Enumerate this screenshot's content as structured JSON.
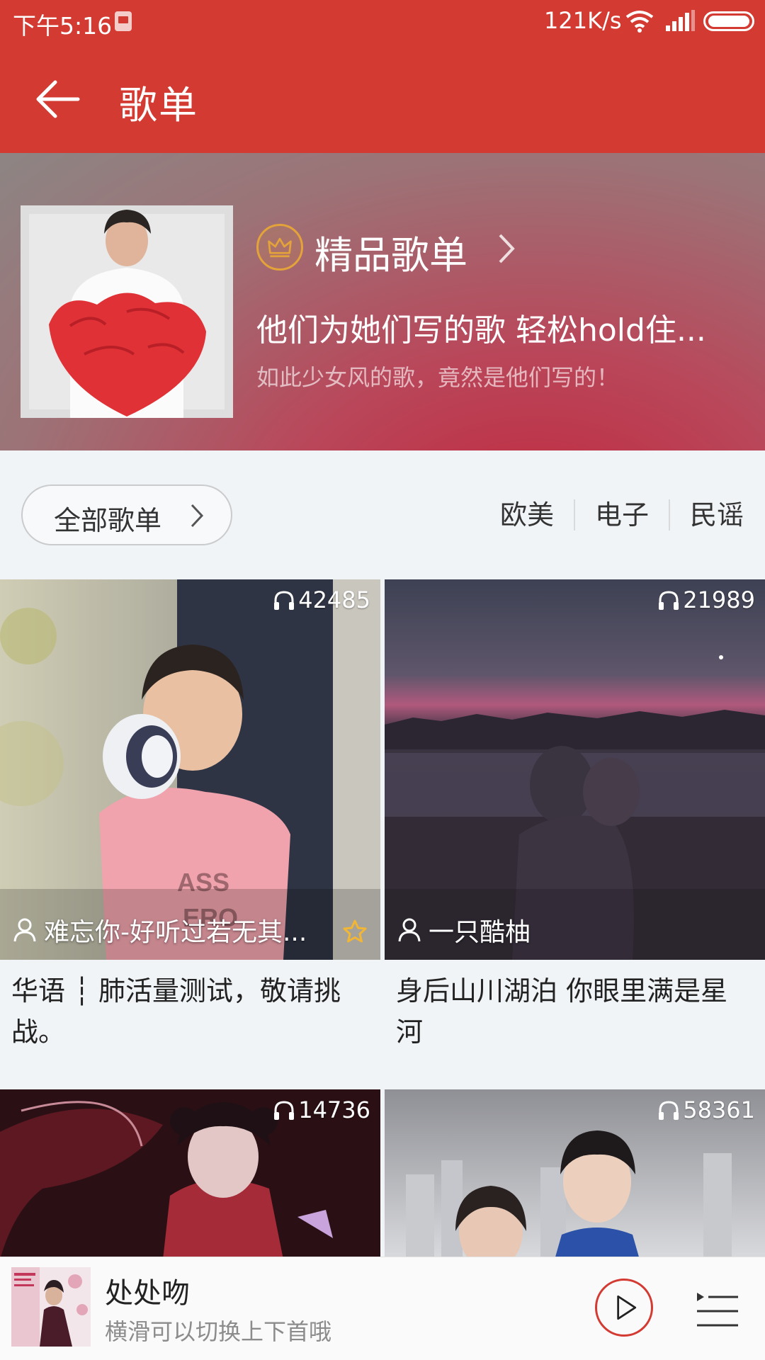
{
  "status_bar": {
    "time": "下午5:16",
    "network_speed": "121K/s"
  },
  "header": {
    "title": "歌单"
  },
  "featured": {
    "label": "精品歌单",
    "title": "他们为她们写的歌 轻松hold住...",
    "subtitle": "如此少女风的歌，竟然是他们写的！"
  },
  "filters": {
    "all_label": "全部歌单",
    "tags": [
      "欧美",
      "电子",
      "民谣"
    ]
  },
  "playlists": [
    {
      "play_count": "42485",
      "creator": "难忘你-好听过若无其...",
      "title": "华语 ┆ 肺活量测试，敬请挑战。",
      "starred": true
    },
    {
      "play_count": "21989",
      "creator": "一只酷柚",
      "title": "身后山川湖泊 你眼里满是星河",
      "starred": false
    },
    {
      "play_count": "14736",
      "creator": "",
      "title": "",
      "starred": false
    },
    {
      "play_count": "58361",
      "creator": "",
      "title": "",
      "starred": false
    }
  ],
  "mini_player": {
    "song_title": "处处吻",
    "hint": "横滑可以切换上下首哦"
  },
  "colors": {
    "brand": "#d33a32",
    "crown": "#e3a33a",
    "background": "#f1f4f7"
  },
  "icons": [
    "back-arrow-icon",
    "crown-icon",
    "chevron-right-icon",
    "headphones-icon",
    "user-icon",
    "star-icon",
    "play-icon",
    "playlist-queue-icon",
    "wifi-icon",
    "signal-icon",
    "battery-icon"
  ]
}
